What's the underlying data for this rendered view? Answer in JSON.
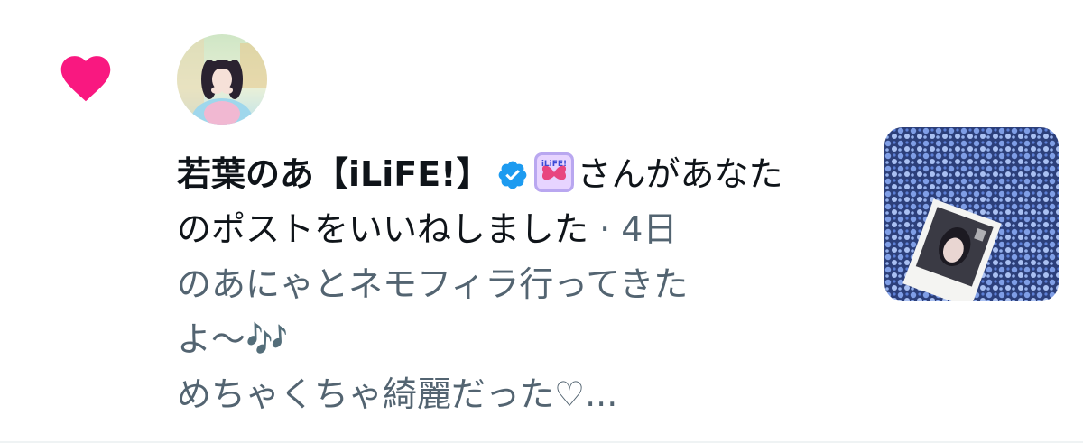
{
  "notification": {
    "liker_name": "若葉のあ【iLiFE!】",
    "affiliation_badge_text": "iLiFE!",
    "action_line1": "さんがあなた",
    "action_line2": "のポストをいいねしました",
    "separator": "·",
    "time_ago": "4日",
    "post_preview": {
      "line1": "のあにゃとネモフィラ行ってきた",
      "line2": "よ〜🎶",
      "line3": "めちゃくちゃ綺麗だった♡..."
    }
  },
  "icons": {
    "like": "heart-icon",
    "verified": "verified-badge-icon"
  },
  "colors": {
    "heart": "#f91880",
    "verified": "#1d9bf0",
    "text": "#0f1419",
    "secondary_text": "#536471"
  }
}
